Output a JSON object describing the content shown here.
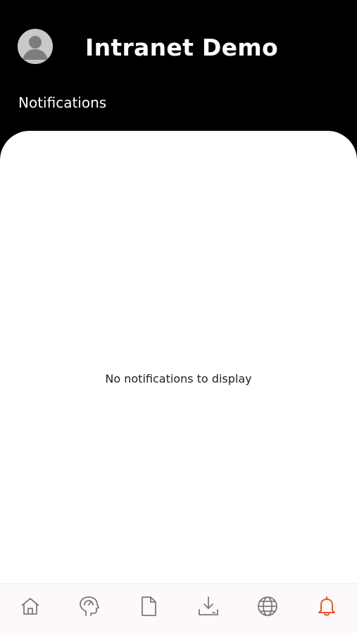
{
  "header": {
    "app_title": "Intranet Demo",
    "section_title": "Notifications",
    "avatar_icon": "user-avatar-icon"
  },
  "notifications": {
    "empty_message": "No notifications to display",
    "items": []
  },
  "tabbar": {
    "tabs": [
      {
        "id": "home",
        "icon": "home-icon",
        "active": false
      },
      {
        "id": "dashboard",
        "icon": "dashboard-head-icon",
        "active": false
      },
      {
        "id": "documents",
        "icon": "document-icon",
        "active": false
      },
      {
        "id": "downloads",
        "icon": "download-icon",
        "active": false
      },
      {
        "id": "web",
        "icon": "globe-icon",
        "active": false
      },
      {
        "id": "notifications",
        "icon": "bell-icon",
        "active": true
      }
    ]
  },
  "colors": {
    "header_background": "#000000",
    "content_background": "#ffffff",
    "tabbar_background": "#fcf8fb",
    "icon_inactive": "#7a7a7a",
    "icon_active": "#e8562a"
  }
}
